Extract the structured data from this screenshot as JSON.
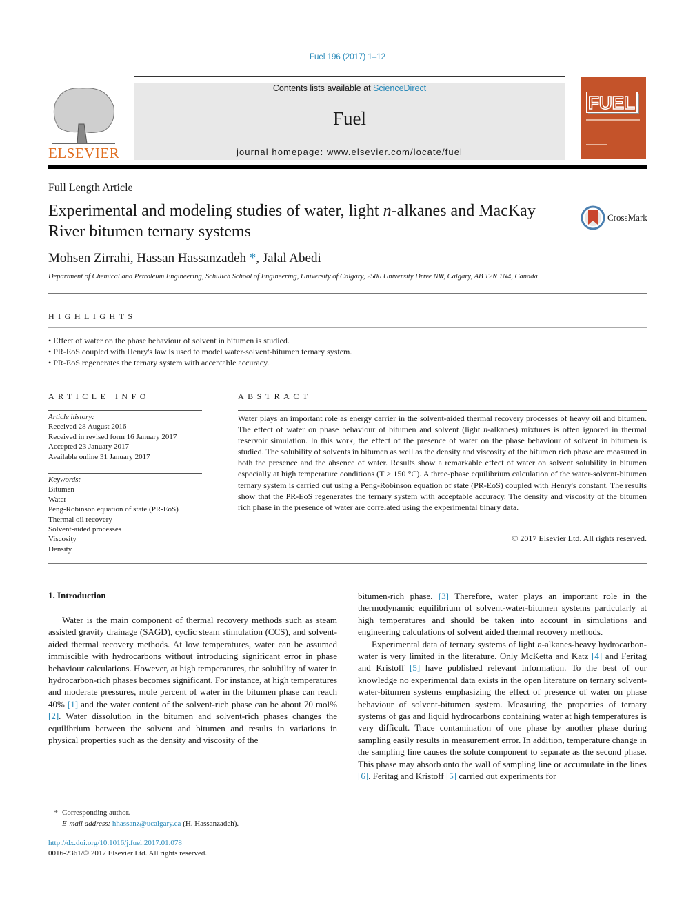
{
  "header": {
    "journal_ref": "Fuel 196 (2017) 1–12",
    "contents_prefix": "Contents lists available at ",
    "contents_link": "ScienceDirect",
    "journal_name": "Fuel",
    "homepage": "journal homepage: www.elsevier.com/locate/fuel",
    "publisher": "ELSEVIER",
    "cover_title": "FUEL"
  },
  "article": {
    "type": "Full Length Article",
    "title_part1": "Experimental and modeling studies of water, light ",
    "title_italic": "n",
    "title_part2": "-alkanes and MacKay River bitumen ternary systems",
    "crossmark": "CrossMark",
    "author1": "Mohsen Zirrahi, Hassan Hassanzadeh ",
    "author_mark": "*",
    "author2": ", Jalal Abedi",
    "affiliation": "Department of Chemical and Petroleum Engineering, Schulich School of Engineering, University of Calgary, 2500 University Drive NW, Calgary, AB T2N 1N4, Canada"
  },
  "highlights": {
    "heading": "HIGHLIGHTS",
    "items": [
      "Effect of water on the phase behaviour of solvent in bitumen is studied.",
      "PR-EoS coupled with Henry's law is used to model water-solvent-bitumen ternary system.",
      "PR-EoS regenerates the ternary system with acceptable accuracy."
    ]
  },
  "article_info": {
    "heading": "ARTICLE INFO",
    "history_label": "Article history:",
    "history": [
      "Received 28 August 2016",
      "Received in revised form 16 January 2017",
      "Accepted 23 January 2017",
      "Available online 31 January 2017"
    ],
    "keywords_label": "Keywords:",
    "keywords": [
      "Bitumen",
      "Water",
      "Peng-Robinson equation of state (PR-EoS)",
      "Thermal oil recovery",
      "Solvent-aided processes",
      "Viscosity",
      "Density"
    ]
  },
  "abstract": {
    "heading": "ABSTRACT",
    "text_a": "Water plays an important role as energy carrier in the solvent-aided thermal recovery processes of heavy oil and bitumen. The effect of water on phase behaviour of bitumen and solvent (light ",
    "text_italic": "n",
    "text_b": "-alkanes) mixtures is often ignored in thermal reservoir simulation. In this work, the effect of the presence of water on the phase behaviour of solvent in bitumen is studied. The solubility of solvents in bitumen as well as the density and viscosity of the bitumen rich phase are measured in both the presence and the absence of water. Results show a remarkable effect of water on solvent solubility in bitumen especially at high temperature conditions (T > 150 °C). A three-phase equilibrium calculation of the water-solvent-bitumen ternary system is carried out using a Peng-Robinson equation of state (PR-EoS) coupled with Henry's constant. The results show that the PR-EoS regenerates the ternary system with acceptable accuracy. The density and viscosity of the bitumen rich phase in the presence of water are correlated using the experimental binary data.",
    "copyright": "© 2017 Elsevier Ltd. All rights reserved."
  },
  "intro": {
    "heading": "1. Introduction",
    "left_p1_a": "Water is the main component of thermal recovery methods such as steam assisted gravity drainage (SAGD), cyclic steam stimulation (CCS), and solvent-aided thermal recovery methods. At low temperatures, water can be assumed immiscible with hydrocarbons without introducing significant error in phase behaviour calculations. However, at high temperatures, the solubility of water in hydrocarbon-rich phases becomes significant. For instance, at high temperatures and moderate pressures, mole percent of water in the bitumen phase can reach 40% ",
    "ref1": "[1]",
    "left_p1_b": " and the water content of the solvent-rich phase can be about 70 mol% ",
    "ref2": "[2]",
    "left_p1_c": ". Water dissolution in the bitumen and solvent-rich phases changes the equilibrium between the solvent and bitumen and results in variations in physical properties such as the density and viscosity of the",
    "right_p1_a": "bitumen-rich phase. ",
    "ref3": "[3]",
    "right_p1_b": " Therefore, water plays an important role in the thermodynamic equilibrium of solvent-water-bitumen systems particularly at high temperatures and should be taken into account in simulations and engineering calculations of solvent aided thermal recovery methods.",
    "right_p2_a": "Experimental data of ternary systems of light ",
    "right_p2_italic": "n",
    "right_p2_b": "-alkanes-heavy hydrocarbon- water is very limited in the literature. Only McKetta and Katz ",
    "ref4": "[4]",
    "right_p2_c": " and Feritag and Kristoff ",
    "ref5": "[5]",
    "right_p2_d": " have published relevant information. To the best of our knowledge no experimental data exists in the open literature on ternary solvent-water-bitumen systems emphasizing the effect of presence of water on phase behaviour of solvent-bitumen system. Measuring the properties of ternary systems of gas and liquid hydrocarbons containing water at high temperatures is very difficult. Trace contamination of one phase by another phase during sampling easily results in measurement error. In addition, temperature change in the sampling line causes the solute component to separate as the second phase. This phase may absorb onto the wall of sampling line or accumulate in the lines ",
    "ref6": "[6]",
    "right_p2_e": ". Feritag and Kristoff ",
    "ref5b": "[5]",
    "right_p2_f": " carried out experiments for"
  },
  "footnote": {
    "mark": "*",
    "corresponding": "Corresponding author.",
    "email_label": "E-mail address: ",
    "email": "hhassanz@ucalgary.ca",
    "email_suffix": " (H. Hassanzadeh).",
    "doi": "http://dx.doi.org/10.1016/j.fuel.2017.01.078",
    "issn": "0016-2361/© 2017 Elsevier Ltd. All rights reserved."
  }
}
